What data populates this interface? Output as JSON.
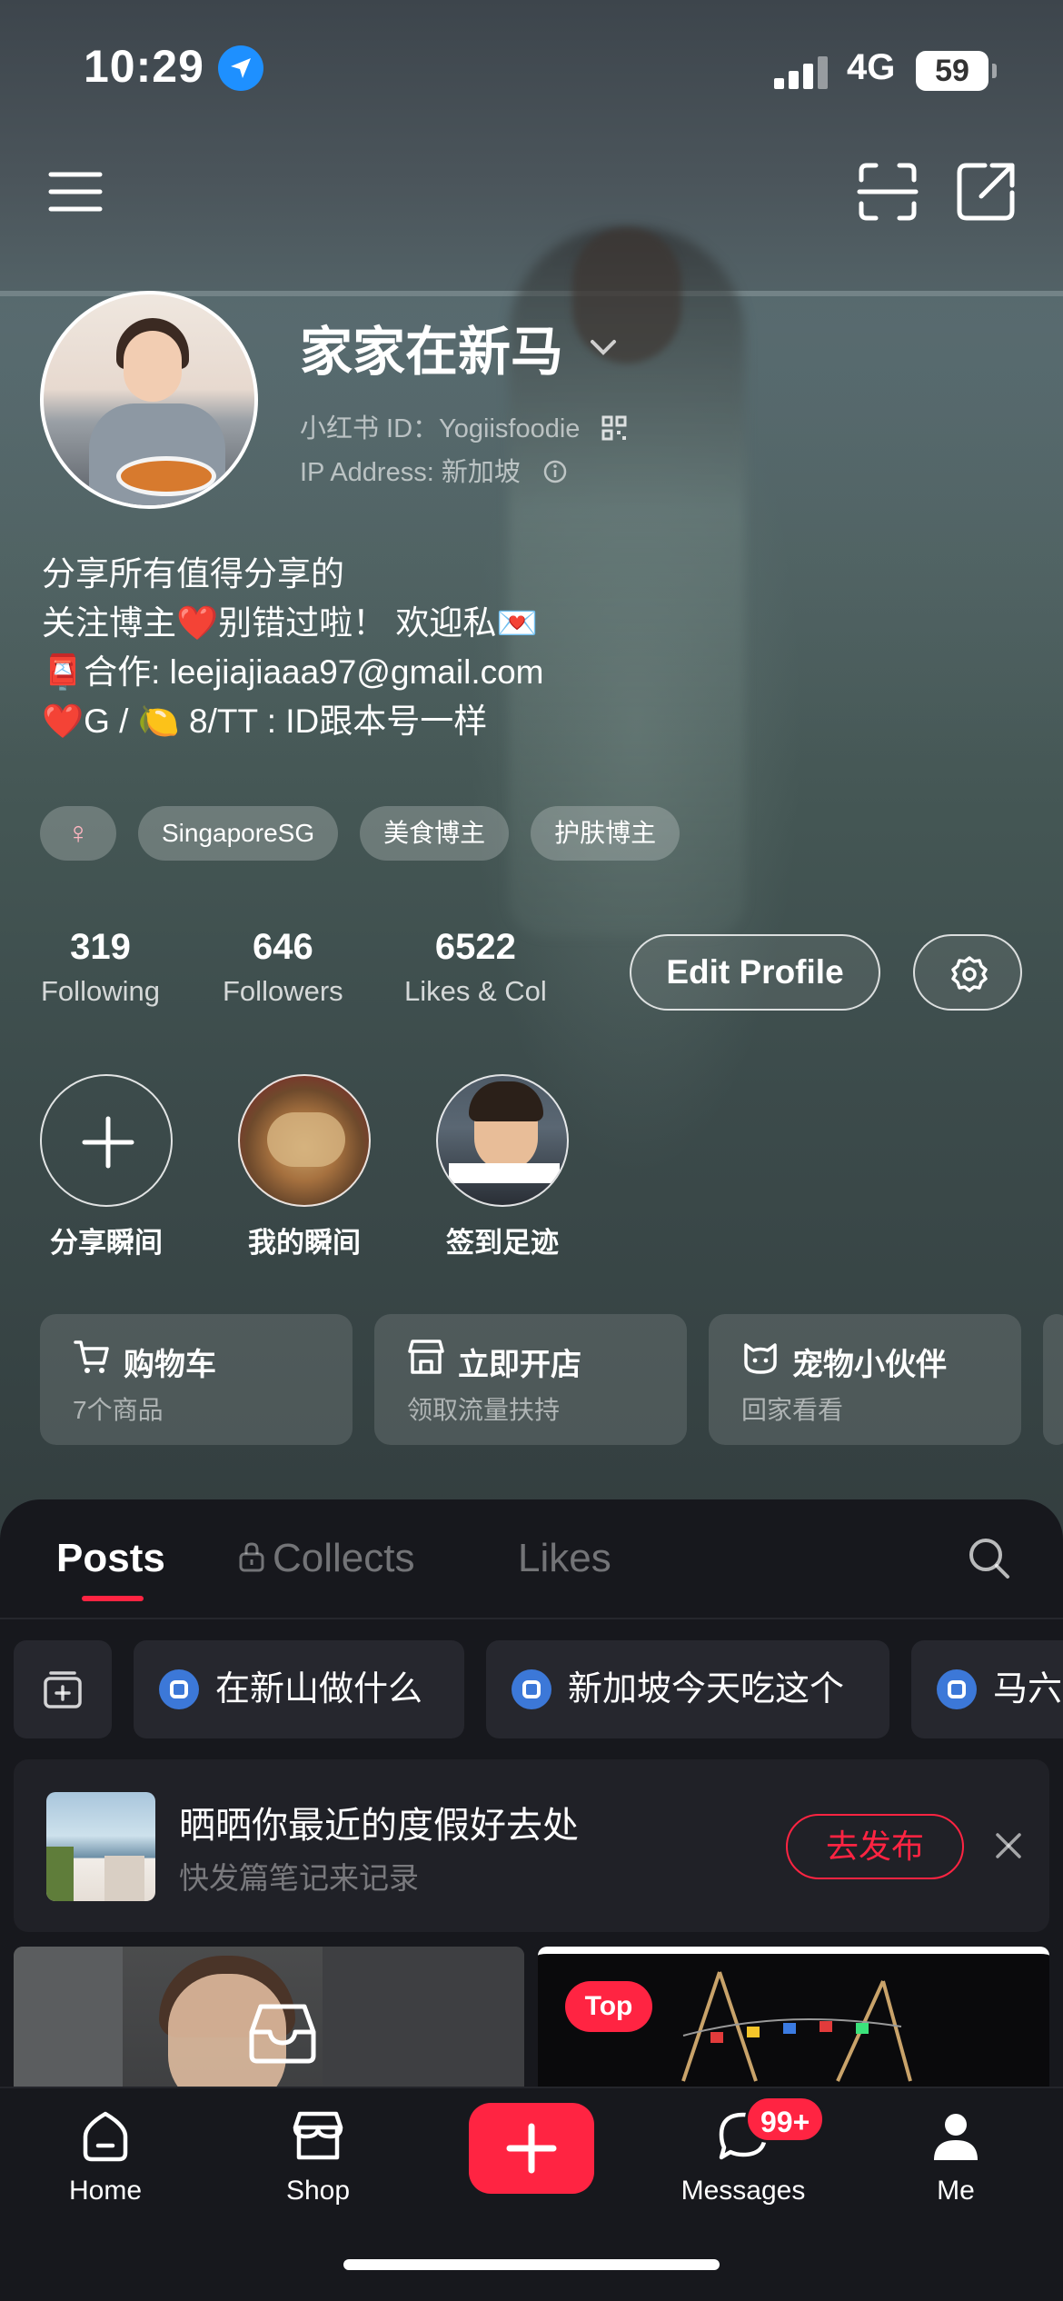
{
  "status_bar": {
    "time": "10:29",
    "network": "4G",
    "battery": "59"
  },
  "profile": {
    "name": "家家在新马",
    "id_line": "小红书 ID：Yogiisfoodie",
    "ip_line": "IP Address: 新加坡",
    "bio": [
      "分享所有值得分享的",
      "关注博主❤️别错过啦！ 欢迎私💌",
      "📮合作: leejiajiaaa97@gmail.com",
      "❤️G / 🍋 8/TT : ID跟本号一样"
    ],
    "tags": [
      "♀",
      "SingaporeSG",
      "美食博主",
      "护肤博主"
    ]
  },
  "stats": [
    {
      "value": "319",
      "label": "Following"
    },
    {
      "value": "646",
      "label": "Followers"
    },
    {
      "value": "6522",
      "label": "Likes & Col"
    }
  ],
  "buttons": {
    "edit_profile": "Edit Profile"
  },
  "moments": [
    {
      "label": "分享瞬间"
    },
    {
      "label": "我的瞬间"
    },
    {
      "label": "签到足迹"
    }
  ],
  "cards": [
    {
      "title": "购物车",
      "sub": "7个商品"
    },
    {
      "title": "立即开店",
      "sub": "领取流量扶持"
    },
    {
      "title": "宠物小伙伴",
      "sub": "回家看看"
    }
  ],
  "content_tabs": [
    "Posts",
    "Collects",
    "Likes"
  ],
  "collections": [
    "在新山做什么",
    "新加坡今天吃这个",
    "马六"
  ],
  "promo": {
    "title": "晒晒你最近的度假好去处",
    "sub": "快发篇笔记来记录",
    "button": "去发布"
  },
  "post_badge": "Top",
  "tabbar": {
    "items": [
      "Home",
      "Shop",
      "Messages",
      "Me"
    ],
    "messages_badge": "99+"
  }
}
